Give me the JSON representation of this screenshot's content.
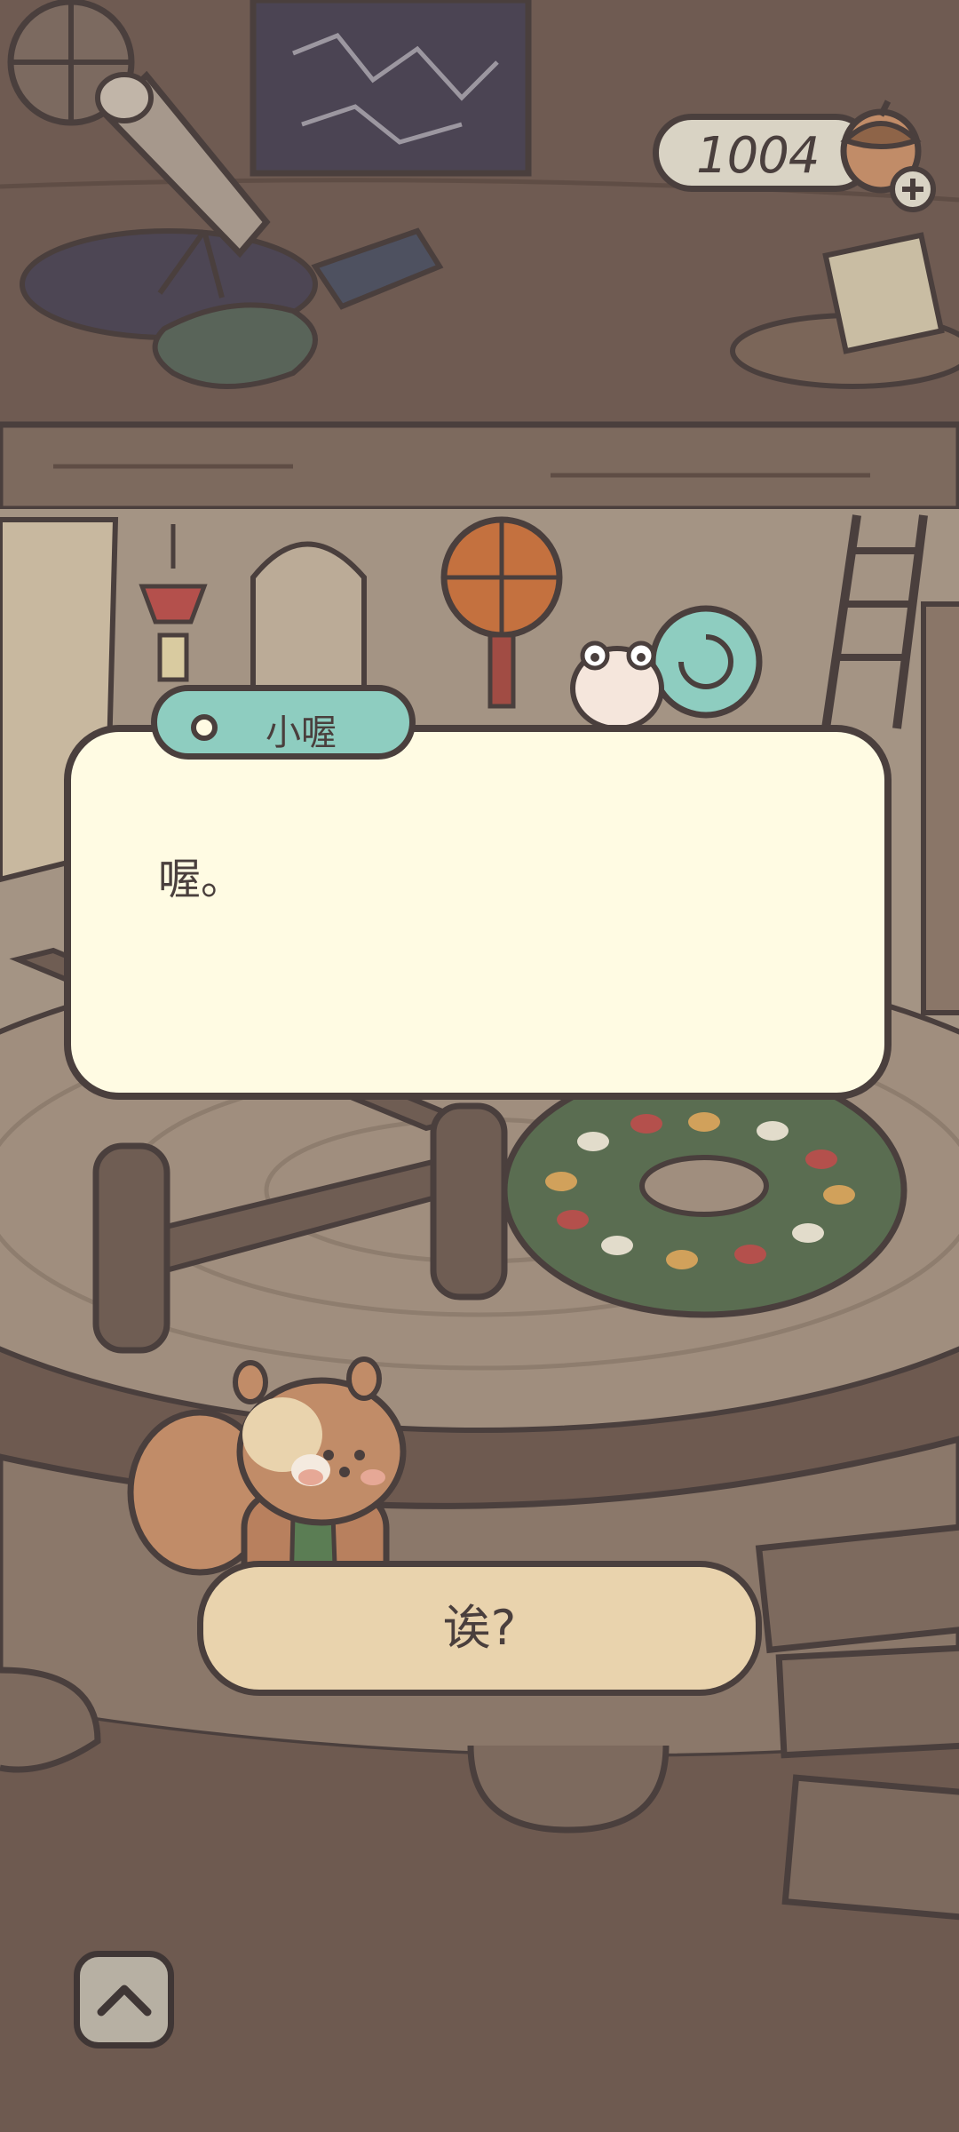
{
  "currency": {
    "value": "1004",
    "icon": "acorn-add-icon"
  },
  "dialog": {
    "speaker": "小喔",
    "text": "喔。"
  },
  "reply": {
    "label": "诶?"
  },
  "controls": {
    "collapse_icon": "chevron-up-icon"
  },
  "colors": {
    "background": "#6e5a50",
    "dialog_fill": "#fffbe3",
    "speaker_tag": "#8ecdc0",
    "reply_fill": "#e9d3ad",
    "outline": "#4a3f3d"
  }
}
